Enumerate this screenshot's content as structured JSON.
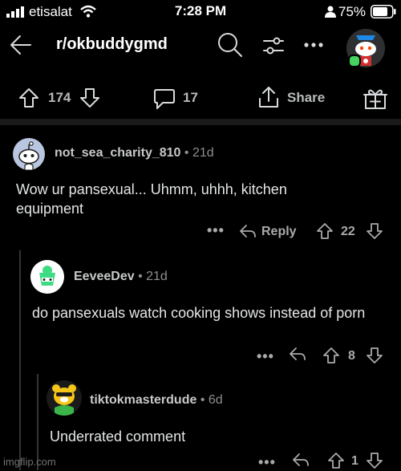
{
  "status_bar": {
    "carrier": "etisalat",
    "time": "7:28 PM",
    "battery": "75%"
  },
  "header": {
    "subreddit": "r/okbuddygmd"
  },
  "post_actions": {
    "votes": "174",
    "comments": "17",
    "share_label": "Share"
  },
  "comments": [
    {
      "user": "not_sea_charity_810",
      "age": "21d",
      "body": "Wow ur pansexual... Uhmm, uhhh, kitchen equipment",
      "reply_label": "Reply",
      "votes": "22"
    },
    {
      "user": "EeveeDev",
      "age": "21d",
      "body": "do pansexuals watch cooking shows instead of porn",
      "votes": "8"
    },
    {
      "user": "tiktokmasterdude",
      "age": "6d",
      "body": "Underrated comment",
      "votes": "1"
    }
  ],
  "watermark": "imgflip.com",
  "colors": {
    "background": "#000000",
    "text": "#d7dadc",
    "muted": "#a8aaab",
    "online": "#46d160"
  }
}
